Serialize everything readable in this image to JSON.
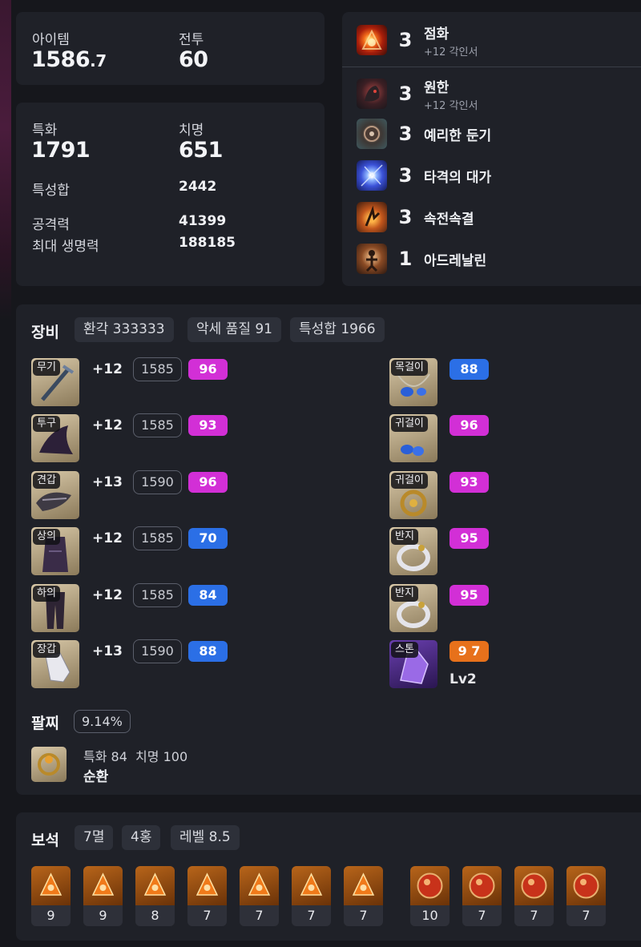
{
  "stats": {
    "item_label": "아이템",
    "item_value_main": "1586",
    "item_value_frac": ".7",
    "combat_label": "전투",
    "combat_value": "60",
    "spec_label": "특화",
    "spec_value": "1791",
    "crit_label": "치명",
    "crit_value": "651",
    "stat_sum_label": "특성합",
    "stat_sum_value": "2442",
    "atk_label": "공격력",
    "atk_value": "41399",
    "hp_label": "최대 생명력",
    "hp_value": "188185"
  },
  "engravings": [
    {
      "level": "3",
      "name": "점화",
      "sub": "+12 각인서",
      "icon": "ignite-icon"
    },
    {
      "level": "3",
      "name": "원한",
      "sub": "+12 각인서",
      "icon": "grudge-icon"
    },
    {
      "level": "3",
      "name": "예리한 둔기",
      "sub": "",
      "icon": "keen-blunt-icon"
    },
    {
      "level": "3",
      "name": "타격의 대가",
      "sub": "",
      "icon": "hit-master-icon"
    },
    {
      "level": "3",
      "name": "속전속결",
      "sub": "",
      "icon": "swift-icon"
    },
    {
      "level": "1",
      "name": "아드레날린",
      "sub": "",
      "icon": "adrenaline-icon"
    }
  ],
  "equipment": {
    "title": "장비",
    "chips": [
      "환각 333333",
      "악세 품질 91",
      "특성합 1966"
    ],
    "armor": [
      {
        "tag": "무기",
        "honing": "+12",
        "level": "1585",
        "quality": "96",
        "color": "pink"
      },
      {
        "tag": "투구",
        "honing": "+12",
        "level": "1585",
        "quality": "93",
        "color": "pink"
      },
      {
        "tag": "견갑",
        "honing": "+13",
        "level": "1590",
        "quality": "96",
        "color": "pink"
      },
      {
        "tag": "상의",
        "honing": "+12",
        "level": "1585",
        "quality": "70",
        "color": "blue"
      },
      {
        "tag": "하의",
        "honing": "+12",
        "level": "1585",
        "quality": "84",
        "color": "blue"
      },
      {
        "tag": "장갑",
        "honing": "+13",
        "level": "1590",
        "quality": "88",
        "color": "blue"
      }
    ],
    "accessories": [
      {
        "tag": "목걸이",
        "quality": "88",
        "color": "blue"
      },
      {
        "tag": "귀걸이",
        "quality": "96",
        "color": "pink"
      },
      {
        "tag": "귀걸이",
        "quality": "93",
        "color": "pink"
      },
      {
        "tag": "반지",
        "quality": "95",
        "color": "pink"
      },
      {
        "tag": "반지",
        "quality": "95",
        "color": "pink"
      },
      {
        "tag": "스톤",
        "quality": "9 7",
        "color": "orange",
        "sub": "Lv2"
      }
    ]
  },
  "bracelet": {
    "title": "팔찌",
    "percent": "9.14%",
    "stats": "특화 84  치명 100",
    "effect": "순환"
  },
  "gems": {
    "title": "보석",
    "chips": [
      "7멸",
      "4홍",
      "레벨 8.5"
    ],
    "items": [
      {
        "level": "9",
        "type": "dmg"
      },
      {
        "level": "9",
        "type": "dmg"
      },
      {
        "level": "8",
        "type": "dmg"
      },
      {
        "level": "7",
        "type": "dmg"
      },
      {
        "level": "7",
        "type": "dmg"
      },
      {
        "level": "7",
        "type": "dmg"
      },
      {
        "level": "7",
        "type": "dmg"
      },
      {
        "level": "10",
        "type": "cd"
      },
      {
        "level": "7",
        "type": "cd"
      },
      {
        "level": "7",
        "type": "cd"
      },
      {
        "level": "7",
        "type": "cd"
      }
    ]
  },
  "colors": {
    "pink": "#d22fd6",
    "blue": "#2b6fe6",
    "orange": "#e7711b",
    "bg": "#16171c",
    "panel": "#1f2128"
  }
}
